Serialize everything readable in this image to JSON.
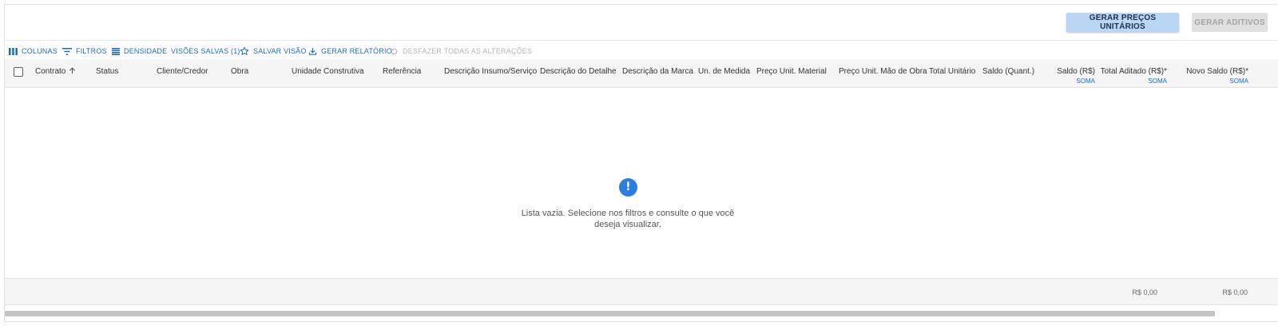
{
  "topbar": {
    "primary_button": "GERAR PREÇOS UNITÁRIOS",
    "disabled_button": "GERAR ADITIVOS"
  },
  "toolbar": {
    "columns": "COLUNAS",
    "filters": "FILTROS",
    "density": "DENSIDADE",
    "saved_views": "VISÕES SALVAS (1)",
    "save_view": "SALVAR VISÃO",
    "report": "GERAR RELATÓRIO",
    "undo_all": "DESFAZER TODAS AS ALTERAÇÕES"
  },
  "table": {
    "columns": [
      "Contrato",
      "Status",
      "Cliente/Credor",
      "Obra",
      "Unidade Construtiva",
      "Referência",
      "Descrição Insumo/Serviço",
      "Descrição do Detalhe",
      "Descrição da Marca",
      "Un. de Medida",
      "Preço Unit. Material",
      "Preço Unit. Mão de Obra",
      "Total Unitário",
      "Saldo (Quant.)",
      "Saldo (R$)",
      "Total Aditado (R$)*",
      "Novo Saldo (R$)*"
    ],
    "sum_label": "SOMA",
    "empty_message": "Lista vazia. Selecione nos filtros e consulte o que você deseja visualizar.",
    "totals": [
      "R$ 0,00",
      "R$ 0,00"
    ]
  },
  "colors": {
    "accent": "#1a6bc9",
    "primary_button_bg": "#b9d6f5",
    "info_icon": "#2a7de1"
  }
}
